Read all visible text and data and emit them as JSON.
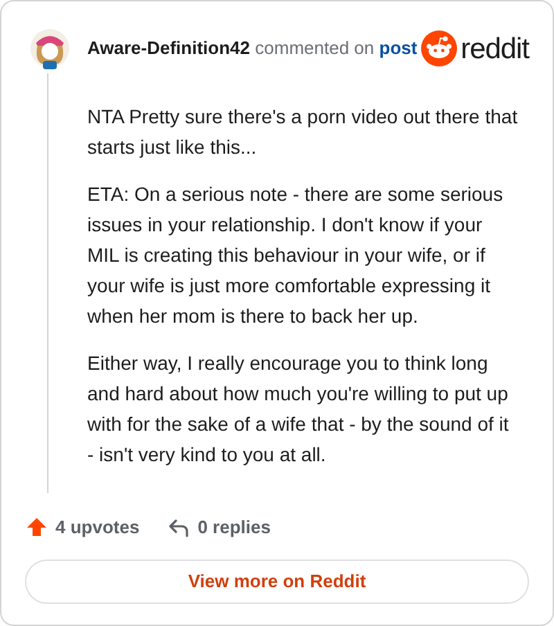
{
  "comment": {
    "author": "Aware-Definition42",
    "action": "commented on",
    "target": "post",
    "paragraphs": [
      "NTA Pretty sure there's a porn video out there that starts just like this...",
      "ETA: On a serious note - there are some serious issues in your relationship. I don't know if your MIL is creating this behaviour in your wife, or if your wife is just more comfortable expressing it when her mom is there to back her up.",
      "Either way, I really encourage you to think long and hard about how much you're willing to put up with for the sake of a wife that - by the sound of it - isn't very kind to you at all."
    ],
    "upvotes": "4 upvotes",
    "replies": "0 replies"
  },
  "brand": "reddit",
  "button": "View more on Reddit"
}
